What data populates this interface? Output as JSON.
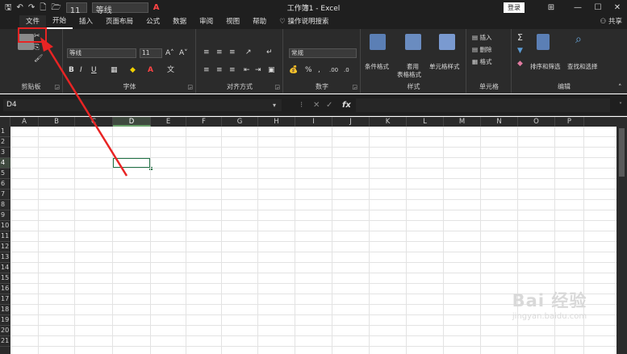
{
  "titlebar": {
    "quick_access": [
      "🖫",
      "↶",
      "↷",
      "🗋",
      "🗁"
    ],
    "font_size": "11",
    "font_name": "等线",
    "font_color_label": "A",
    "title": "工作簿1 - Excel",
    "login": "登录",
    "controls": [
      "⊞",
      "—",
      "☐",
      "✕"
    ]
  },
  "tabs": [
    "文件",
    "开始",
    "插入",
    "页面布局",
    "公式",
    "数据",
    "审阅",
    "视图",
    "帮助"
  ],
  "active_tab_index": 1,
  "tell_me": "操作说明搜索",
  "share": "共享",
  "ribbon": {
    "clipboard": {
      "label": "剪贴板"
    },
    "font": {
      "label": "字体",
      "font_name": "等线",
      "font_size": "11",
      "grow": "A˄",
      "shrink": "A˅",
      "bold": "B",
      "italic": "I",
      "underline": "U"
    },
    "alignment": {
      "label": "对齐方式"
    },
    "number": {
      "label": "数字",
      "format": "常规",
      "percent": "%",
      "comma": ","
    },
    "styles": {
      "label": "样式",
      "conditional": "条件格式",
      "table_format_line1": "套用",
      "table_format_line2": "表格格式",
      "cell_styles": "单元格样式"
    },
    "cells": {
      "label": "单元格",
      "insert": "插入",
      "delete": "删除",
      "format": "格式"
    },
    "editing": {
      "label": "编辑",
      "sort": "排序和筛选",
      "find": "查找和选择"
    }
  },
  "formula_bar": {
    "name_box": "D4",
    "cancel": "✕",
    "enter": "✓",
    "fx": "fx",
    "value": ""
  },
  "columns": [
    "A",
    "B",
    "C",
    "D",
    "E",
    "F",
    "G",
    "H",
    "I",
    "J",
    "K",
    "L",
    "M",
    "N",
    "O",
    "P"
  ],
  "rows": [
    "1",
    "2",
    "3",
    "4",
    "5",
    "6",
    "7",
    "8",
    "9",
    "10",
    "11",
    "12",
    "13",
    "14",
    "15",
    "16",
    "17",
    "18",
    "19",
    "20",
    "21"
  ],
  "selected_cell": {
    "column": "D",
    "row": "4"
  },
  "watermark": {
    "logo": "Bai 经验",
    "url": "jingyan.baidu.com"
  },
  "colors": {
    "accent": "#217346",
    "annotation": "#e82424",
    "dark_bg": "#1f1f1f",
    "ribbon_bg": "#2b2b2b"
  }
}
